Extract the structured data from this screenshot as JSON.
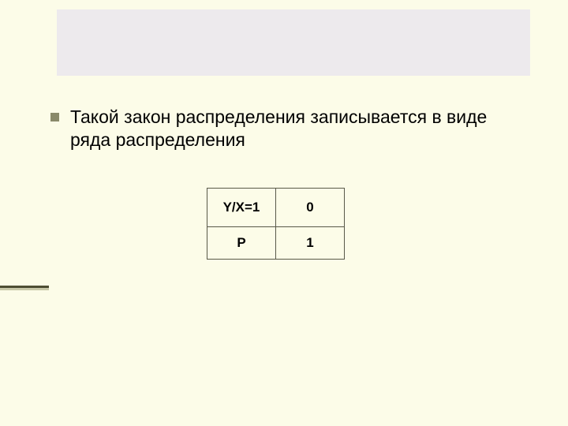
{
  "body": {
    "bullet_text": "Такой закон распределения записывается в виде ряда распределения"
  },
  "table": {
    "r1c1": "Y/X=1",
    "r1c2": "0",
    "r2c1": "P",
    "r2c2": "1"
  }
}
